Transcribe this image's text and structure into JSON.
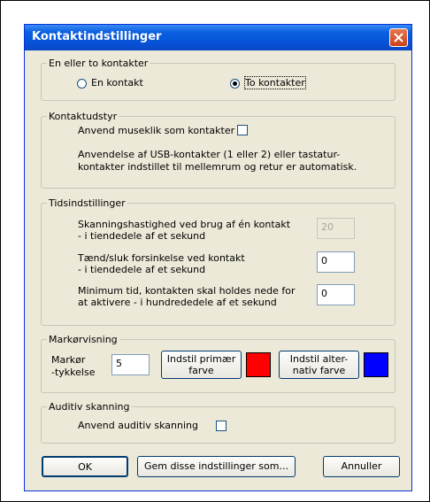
{
  "window": {
    "title": "Kontaktindstillinger"
  },
  "group_contacts": {
    "legend": "En eller to kontakter",
    "one_label": "En kontakt",
    "two_label": "To kontakter",
    "selected": "two"
  },
  "group_equipment": {
    "legend": "Kontaktudstyr",
    "mouse_label": "Anvend museklik som kontakter",
    "mouse_checked": false,
    "info_line1": "Anvendelse af USB-kontakter (1 eller 2) eller tastatur-",
    "info_line2": "kontakter indstillet til mellemrum og retur er automatisk."
  },
  "group_timing": {
    "legend": "Tidsindstillinger",
    "scan_label1": "Skanningshastighed ved brug af én kontakt",
    "scan_label2": "- i tiendedele af et sekund",
    "scan_value": "20",
    "delay_label1": "Tænd/sluk forsinkelse ved kontakt",
    "delay_label2": "- i tiendedele af et sekund",
    "delay_value": "0",
    "hold_label1": "Minimum tid, kontakten skal holdes nede for",
    "hold_label2": "at aktivere - i hundrededele af et sekund",
    "hold_value": "0"
  },
  "group_cursor": {
    "legend": "Markørvisning",
    "thickness_label1": "Markør",
    "thickness_label2": "-tykkelse",
    "thickness_value": "5",
    "primary_btn1": "Indstil primær",
    "primary_btn2": "farve",
    "primary_color": "#ff0000",
    "alt_btn1": "Indstil alter-",
    "alt_btn2": "nativ farve",
    "alt_color": "#0000ff"
  },
  "group_audio": {
    "legend": "Auditiv skanning",
    "audio_label": "Anvend auditiv skanning",
    "audio_checked": false
  },
  "buttons": {
    "ok": "OK",
    "save_as": "Gem disse indstillinger som...",
    "cancel": "Annuller"
  }
}
